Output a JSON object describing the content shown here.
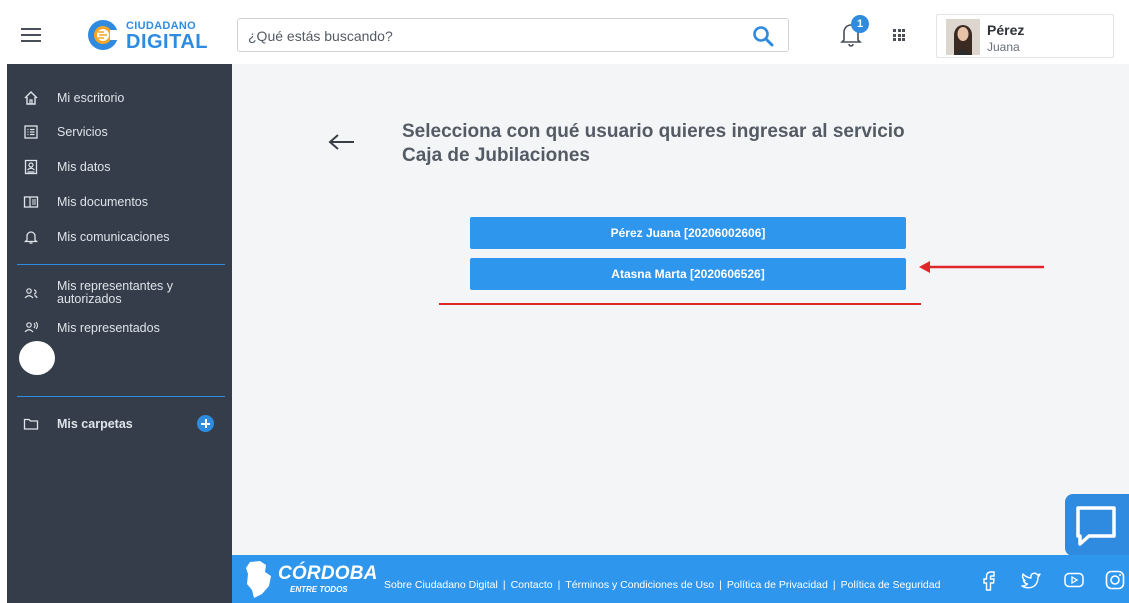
{
  "header": {
    "logo_top": "CIUDADANO",
    "logo_bottom": "DIGITAL",
    "search_placeholder": "¿Qué estás buscando?",
    "notification_count": "1",
    "user": {
      "last_name": "Pérez",
      "first_name": "Juana"
    }
  },
  "sidebar": {
    "items": [
      {
        "label": "Mi escritorio",
        "icon": "home-icon"
      },
      {
        "label": "Servicios",
        "icon": "services-list-icon"
      },
      {
        "label": "Mis datos",
        "icon": "id-card-icon"
      },
      {
        "label": "Mis documentos",
        "icon": "documents-icon"
      },
      {
        "label": "Mis comunicaciones",
        "icon": "bell-icon"
      }
    ],
    "reps": [
      {
        "label_line1": "Mis representantes y",
        "label_line2": "autorizados",
        "icon": "representatives-icon"
      },
      {
        "label": "Mis representados",
        "icon": "represented-icon"
      }
    ],
    "folders_label": "Mis carpetas"
  },
  "main": {
    "title_line1": "Selecciona con qué usuario quieres ingresar al servicio",
    "title_line2": "Caja de Jubilaciones",
    "user_options": [
      "Pérez Juana [20206002606]",
      "Atasna Marta [2020606526]"
    ]
  },
  "footer": {
    "logo_main": "CÓRDOBA",
    "logo_sub": "ENTRE TODOS",
    "links": [
      "Sobre Ciudadano Digital",
      "Contacto",
      "Términos y Condiciones de Uso",
      "Política de Privacidad",
      "Política de Seguridad"
    ]
  },
  "colors": {
    "accent": "#2f96ee",
    "sidebar_bg": "#343d49",
    "annotation_red": "#e0262a"
  }
}
